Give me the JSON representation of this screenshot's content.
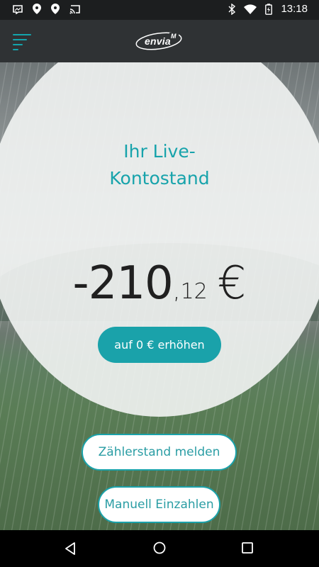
{
  "status_bar": {
    "time": "13:18",
    "icons": [
      "screenshot-icon",
      "location-icon",
      "location-icon",
      "cast-icon",
      "bluetooth-icon",
      "wifi-icon",
      "battery-icon"
    ]
  },
  "app_bar": {
    "logo_text": "envia",
    "logo_mark": "M",
    "menu_icon": "hamburger-menu-icon"
  },
  "balance_card": {
    "title_line1": "Ihr Live-",
    "title_line2": "Kontostand",
    "amount_main": "-210",
    "amount_separator": ",",
    "amount_cents": "12",
    "currency": "€",
    "raise_button_label": "auf 0 € erhöhen"
  },
  "actions": {
    "meter_button_label": "Zählerstand melden",
    "pay_button_label": "Manuell Einzahlen"
  },
  "nav_bar": {
    "icons": [
      "back-icon",
      "home-icon",
      "recents-icon"
    ]
  },
  "colors": {
    "accent": "#1aa2aa",
    "appbar": "#2f3234",
    "statusbar": "#1c1e1f"
  }
}
